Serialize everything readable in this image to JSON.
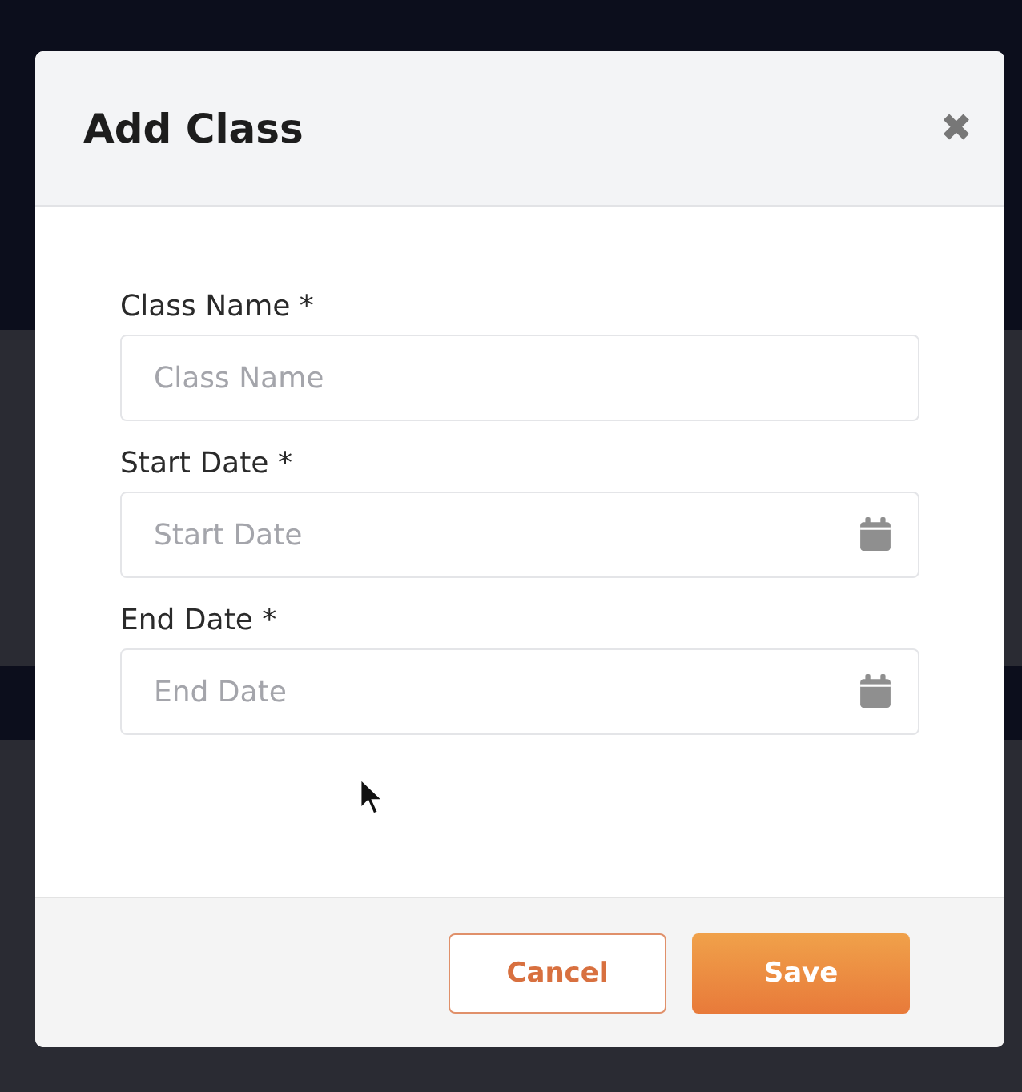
{
  "dialog": {
    "title": "Add Class",
    "close": "✖"
  },
  "fields": [
    {
      "kind": "text",
      "label": "Class Name *",
      "placeholder": "Class Name"
    },
    {
      "kind": "date",
      "label": "Start Date *",
      "placeholder": "Start Date"
    },
    {
      "kind": "date",
      "label": "End Date *",
      "placeholder": "End Date"
    }
  ],
  "buttons": [
    {
      "kind": "secondary",
      "label": "Cancel"
    },
    {
      "kind": "primary",
      "label": "Save"
    }
  ]
}
